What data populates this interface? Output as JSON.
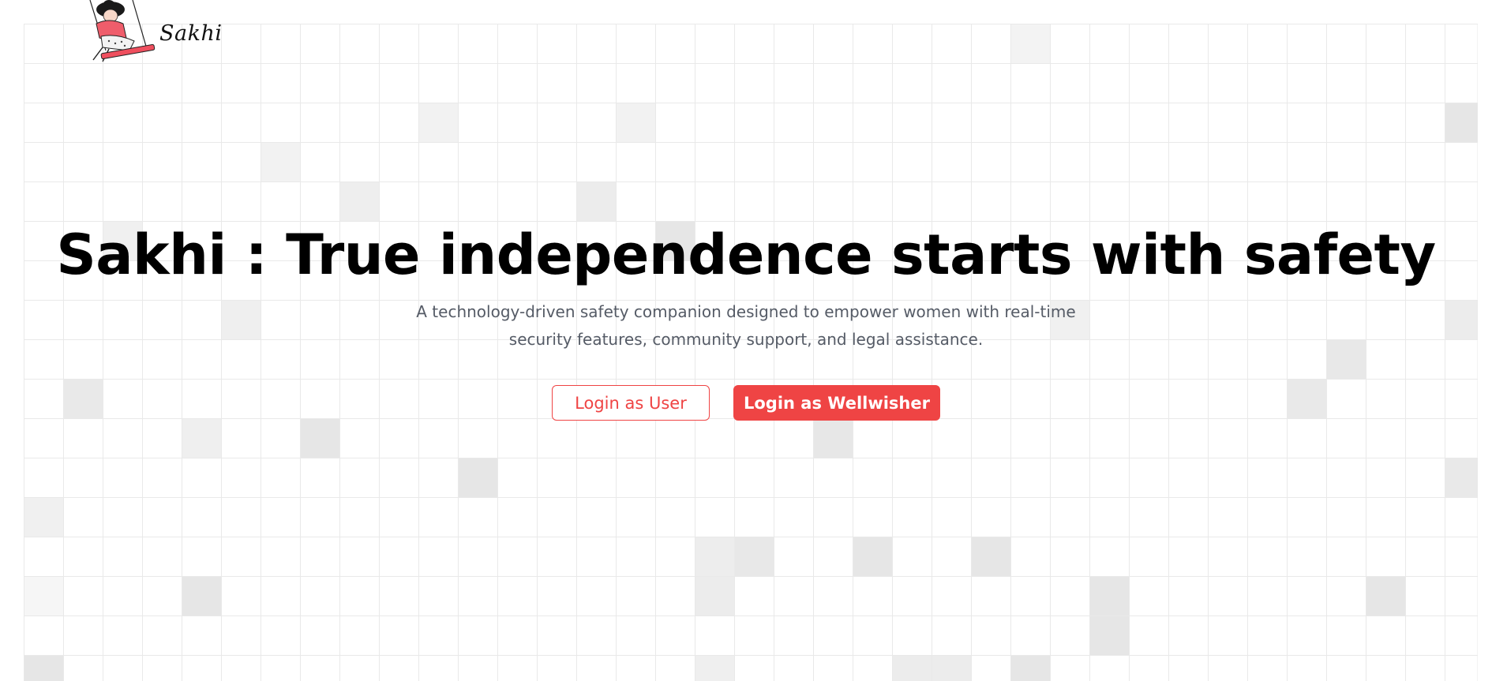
{
  "brand": {
    "name": "Sakhi",
    "logo_icon": "woman-on-swing-icon",
    "accent_color": "#ef4444"
  },
  "hero": {
    "title": "Sakhi : True independence starts with safety",
    "subtitle": "A technology-driven safety companion designed to empower women with real-time security features, community support, and legal assistance."
  },
  "actions": {
    "login_user_label": "Login as User",
    "login_wellwisher_label": "Login as Wellwisher"
  }
}
